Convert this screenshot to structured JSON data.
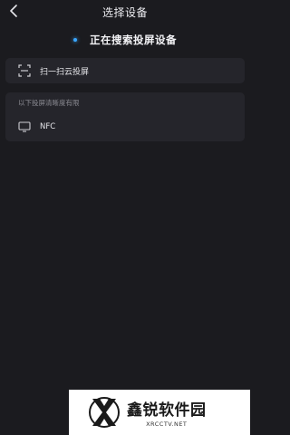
{
  "header": {
    "title": "选择设备",
    "back_icon": "chevron-left-icon"
  },
  "status": {
    "searching_text": "正在搜索投屏设备",
    "indicator_color": "#3aa7ff"
  },
  "scan": {
    "label": "扫一扫云投屏",
    "icon": "scan-frame-icon"
  },
  "devices": {
    "section_label": "以下投屏清晰度有限",
    "items": [
      {
        "name": "NFC",
        "icon": "tv-icon"
      }
    ]
  },
  "watermark": {
    "name": "鑫锐软件园",
    "url": "XRCCTV.NET"
  }
}
